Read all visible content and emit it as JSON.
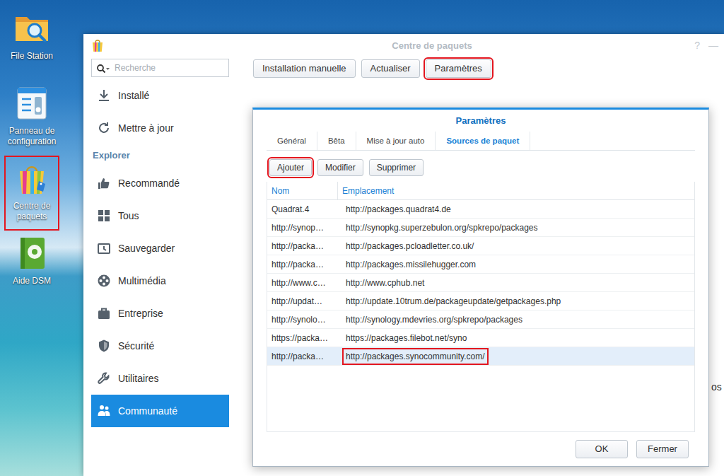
{
  "desktop": {
    "icons": [
      {
        "label": "File Station",
        "annotated": false
      },
      {
        "label": "Panneau de configuration",
        "annotated": false
      },
      {
        "label": "Centre de paquets",
        "annotated": true
      },
      {
        "label": "Aide DSM",
        "annotated": false
      }
    ]
  },
  "window": {
    "title": "Centre de paquets",
    "controls": [
      "?",
      "—"
    ]
  },
  "search": {
    "placeholder": "Recherche"
  },
  "sidebar": {
    "items": [
      {
        "label": "Installé",
        "kind": "item",
        "selected": false
      },
      {
        "label": "Mettre à jour",
        "kind": "item",
        "selected": false
      },
      {
        "label": "Explorer",
        "kind": "header",
        "selected": false
      },
      {
        "label": "Recommandé",
        "kind": "item",
        "selected": false
      },
      {
        "label": "Tous",
        "kind": "item",
        "selected": false
      },
      {
        "label": "Sauvegarder",
        "kind": "item",
        "selected": false
      },
      {
        "label": "Multimédia",
        "kind": "item",
        "selected": false
      },
      {
        "label": "Entreprise",
        "kind": "item",
        "selected": false
      },
      {
        "label": "Sécurité",
        "kind": "item",
        "selected": false
      },
      {
        "label": "Utilitaires",
        "kind": "item",
        "selected": false
      },
      {
        "label": "Communauté",
        "kind": "item",
        "selected": true
      }
    ]
  },
  "toolbar": {
    "buttons": [
      {
        "label": "Installation manuelle",
        "annotated": false
      },
      {
        "label": "Actualiser",
        "annotated": false
      },
      {
        "label": "Paramètres",
        "annotated": true
      }
    ]
  },
  "background_text": "os",
  "dialog": {
    "title": "Paramètres",
    "tabs": [
      {
        "label": "Général",
        "selected": false
      },
      {
        "label": "Bêta",
        "selected": false
      },
      {
        "label": "Mise à jour auto",
        "selected": false
      },
      {
        "label": "Sources de paquet",
        "selected": true
      }
    ],
    "buttons": [
      {
        "label": "Ajouter",
        "annotated": true
      },
      {
        "label": "Modifier",
        "annotated": false
      },
      {
        "label": "Supprimer",
        "annotated": false
      }
    ],
    "table": {
      "columns": [
        "Nom",
        "Emplacement"
      ],
      "rows": [
        {
          "cells": [
            "Quadrat.4",
            "http://packages.quadrat4.de"
          ],
          "selected": false,
          "annotated": false
        },
        {
          "cells": [
            "http://synop…",
            "http://synopkg.superzebulon.org/spkrepo/packages"
          ],
          "selected": false,
          "annotated": false
        },
        {
          "cells": [
            "http://packa…",
            "http://packages.pcloadletter.co.uk/"
          ],
          "selected": false,
          "annotated": false
        },
        {
          "cells": [
            "http://packa…",
            "http://packages.missilehugger.com"
          ],
          "selected": false,
          "annotated": false
        },
        {
          "cells": [
            "http://www.c…",
            "http://www.cphub.net"
          ],
          "selected": false,
          "annotated": false
        },
        {
          "cells": [
            "http://updat…",
            "http://update.10trum.de/packageupdate/getpackages.php"
          ],
          "selected": false,
          "annotated": false
        },
        {
          "cells": [
            "http://synolo…",
            "http://synology.mdevries.org/spkrepo/packages"
          ],
          "selected": false,
          "annotated": false
        },
        {
          "cells": [
            "https://packa…",
            "https://packages.filebot.net/syno"
          ],
          "selected": false,
          "annotated": false
        },
        {
          "cells": [
            "http://packa…",
            "http://packages.synocommunity.com/"
          ],
          "selected": true,
          "annotated": true
        }
      ]
    },
    "footer_buttons": [
      "OK",
      "Fermer"
    ]
  }
}
